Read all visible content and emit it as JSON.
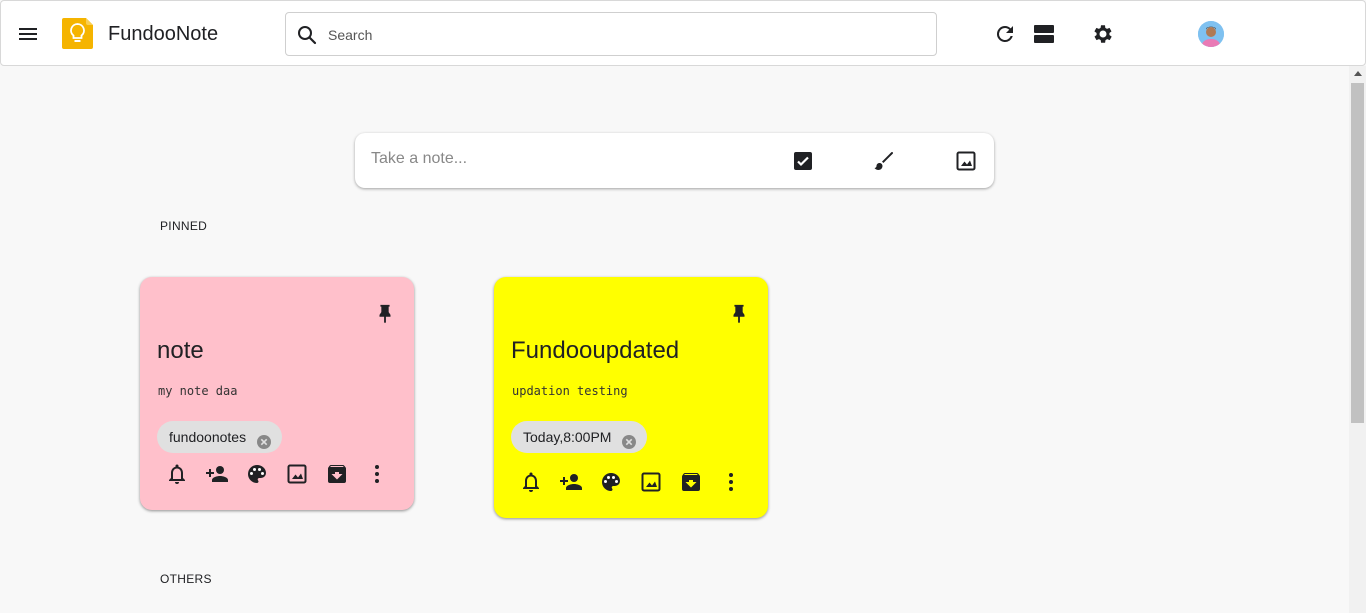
{
  "header": {
    "app_title": "FundooNote",
    "search_placeholder": "Search",
    "icons": [
      "menu-icon",
      "logo-bulb-icon",
      "search-icon",
      "refresh-icon",
      "list-view-icon",
      "settings-icon",
      "avatar"
    ]
  },
  "take_note": {
    "placeholder": "Take a note...",
    "icons": [
      "checkbox-icon",
      "brush-icon",
      "image-icon"
    ]
  },
  "sections": {
    "pinned_label": "PINNED",
    "others_label": "OTHERS"
  },
  "notes": [
    {
      "title": "note",
      "body": "my note daa",
      "chip": "fundoonotes",
      "color": "#ffc0cb",
      "pinned": true
    },
    {
      "title": "Fundooupdated",
      "body": "updation testing",
      "chip": "Today,8:00PM",
      "color": "#ffff00",
      "pinned": true
    }
  ],
  "note_actions": [
    "reminder-icon",
    "collaborator-icon",
    "palette-icon",
    "image-icon",
    "archive-icon",
    "more-icon"
  ],
  "colors": {
    "accent": "#fbbc04",
    "background": "#f8f8f8"
  }
}
